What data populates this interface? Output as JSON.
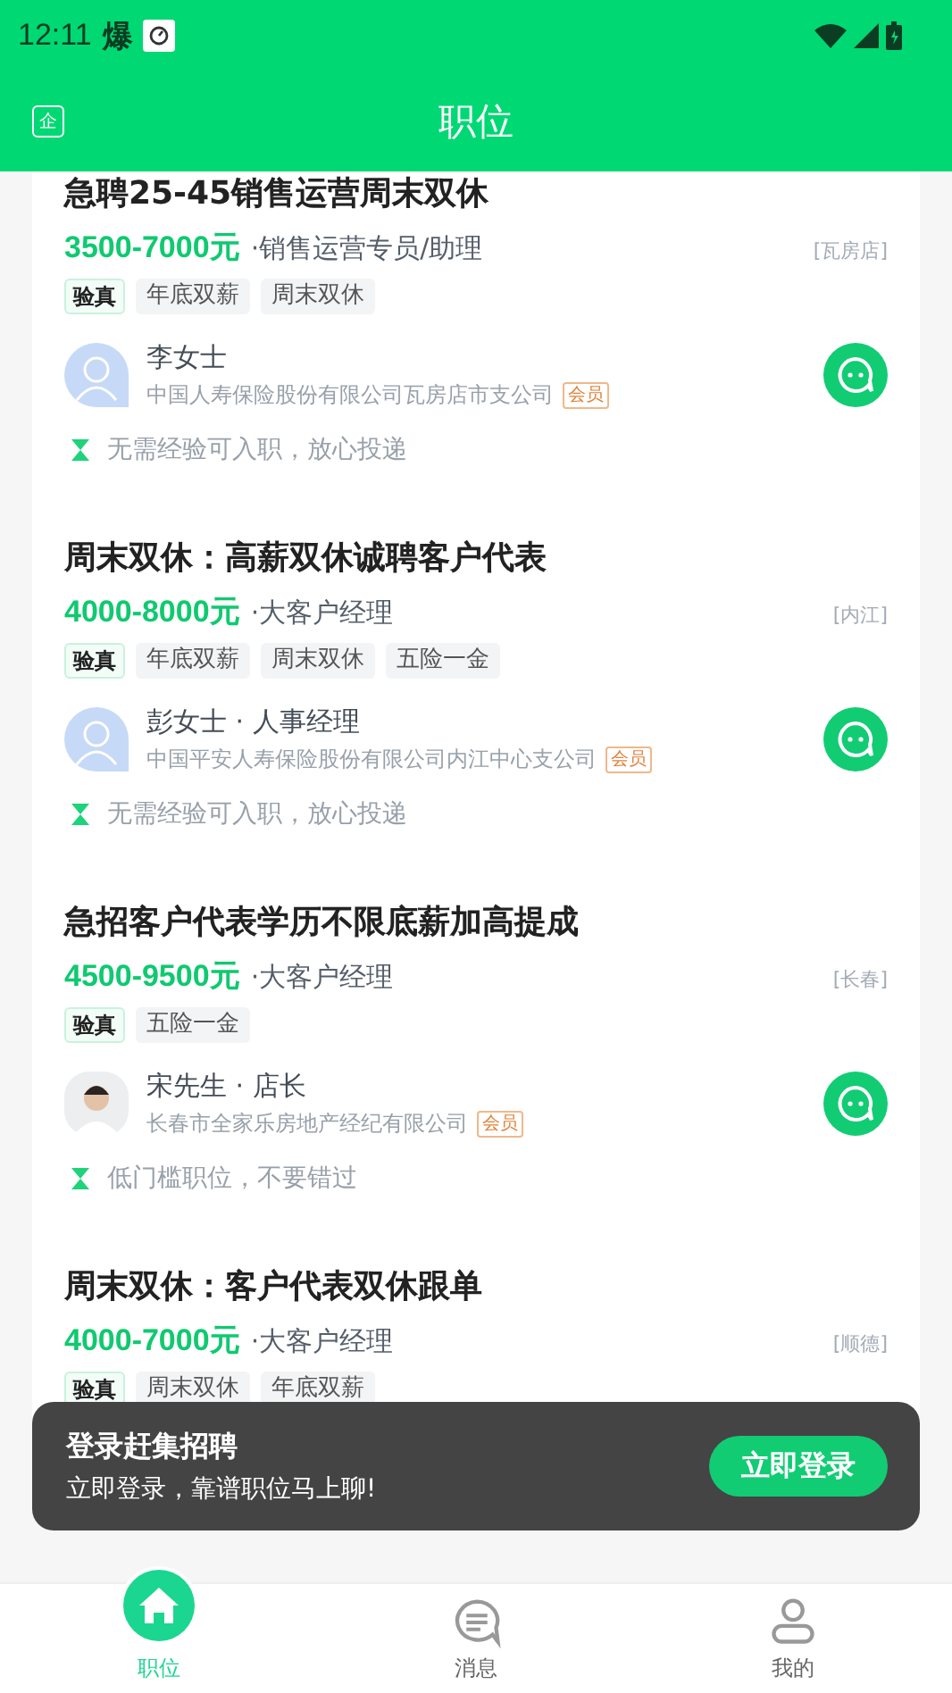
{
  "status_bar": {
    "time": "12:11",
    "notification": "爆"
  },
  "header": {
    "title": "职位",
    "badge": "企"
  },
  "jobs": [
    {
      "title": "急聘25-45销售运营周末双休",
      "salary": "3500-7000元",
      "position": "·销售运营专员/助理",
      "location": "[瓦房店]",
      "verified": "验真",
      "tags": [
        "年底双薪",
        "周末双休"
      ],
      "contact": {
        "name": "李女士",
        "company": "中国人寿保险股份有限公司瓦房店市支公司",
        "member": "会员",
        "kind": "placeholder"
      },
      "hint": "无需经验可入职，放心投递"
    },
    {
      "title": "周末双休：高薪双休诚聘客户代表",
      "salary": "4000-8000元",
      "position": "·大客户经理",
      "location": "[内江]",
      "verified": "验真",
      "tags": [
        "年底双薪",
        "周末双休",
        "五险一金"
      ],
      "contact": {
        "name": "彭女士 · 人事经理",
        "company": "中国平安人寿保险股份有限公司内江中心支公司",
        "member": "会员",
        "kind": "placeholder"
      },
      "hint": "无需经验可入职，放心投递"
    },
    {
      "title": "急招客户代表学历不限底薪加高提成",
      "salary": "4500-9500元",
      "position": "·大客户经理",
      "location": "[长春]",
      "verified": "验真",
      "tags": [
        "五险一金"
      ],
      "contact": {
        "name": "宋先生 · 店长",
        "company": "长春市全家乐房地产经纪有限公司",
        "member": "会员",
        "kind": "photo"
      },
      "hint": "低门槛职位，不要错过"
    },
    {
      "title": "周末双休：客户代表双休跟单",
      "salary": "4000-7000元",
      "position": "·大客户经理",
      "location": "[顺德]",
      "verified": "验真",
      "tags": [
        "周末双休",
        "年底双薪"
      ]
    }
  ],
  "toast": {
    "title": "登录赶集招聘",
    "message": "立即登录，靠谱职位马上聊!",
    "button": "立即登录"
  },
  "tabs": [
    {
      "label": "职位",
      "kind": "home",
      "selected": true
    },
    {
      "label": "消息",
      "kind": "chat",
      "selected": false
    },
    {
      "label": "我的",
      "kind": "person",
      "selected": false
    }
  ]
}
